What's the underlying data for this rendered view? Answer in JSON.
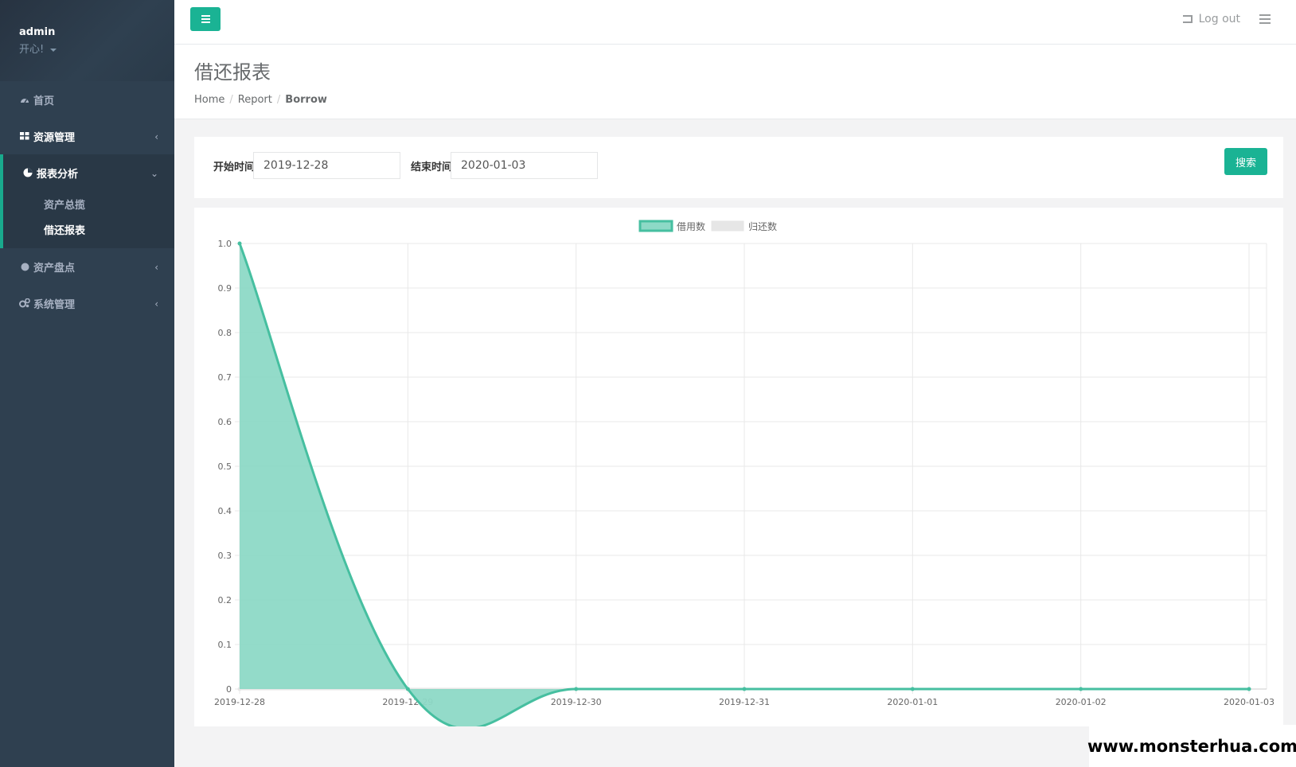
{
  "user": {
    "name": "admin",
    "role": "开心!"
  },
  "sidebar": {
    "items": [
      {
        "label": "首页",
        "icon": "dashboard-icon"
      },
      {
        "label": "资源管理",
        "icon": "grid-icon"
      },
      {
        "label": "报表分析",
        "icon": "pie-chart-icon",
        "sub": [
          "资产总揽",
          "借还报表"
        ]
      },
      {
        "label": "资产盘点",
        "icon": "circle-icon"
      },
      {
        "label": "系统管理",
        "icon": "cogs-icon"
      }
    ]
  },
  "topbar": {
    "logout": "Log out"
  },
  "page": {
    "title": "借还报表",
    "breadcrumb": [
      "Home",
      "Report",
      "Borrow"
    ]
  },
  "search": {
    "start_label": "开始时间",
    "start_value": "2019-12-28",
    "end_label": "结束时间",
    "end_value": "2020-01-03",
    "button": "搜索"
  },
  "watermark": "www.monsterhua.com",
  "colors": {
    "accent": "#1ab394",
    "sidebar": "#2f4050",
    "series_borrow": "#46bfa0",
    "series_borrow_fill": "#8dd9c6",
    "series_return": "#e6e6e6"
  },
  "chart_data": {
    "type": "area",
    "categories": [
      "2019-12-28",
      "2019-12-29",
      "2019-12-30",
      "2019-12-31",
      "2020-01-01",
      "2020-01-02",
      "2020-01-03"
    ],
    "series": [
      {
        "name": "借用数",
        "values": [
          1,
          0,
          0,
          0,
          0,
          0,
          0
        ]
      },
      {
        "name": "归还数",
        "values": [
          0,
          0,
          0,
          0,
          0,
          0,
          0
        ]
      }
    ],
    "ylim": [
      0,
      1
    ],
    "yticks": [
      "0",
      "0.1",
      "0.2",
      "0.3",
      "0.4",
      "0.5",
      "0.6",
      "0.7",
      "0.8",
      "0.9",
      "1.0"
    ],
    "grid": true,
    "legend": "top-center"
  }
}
